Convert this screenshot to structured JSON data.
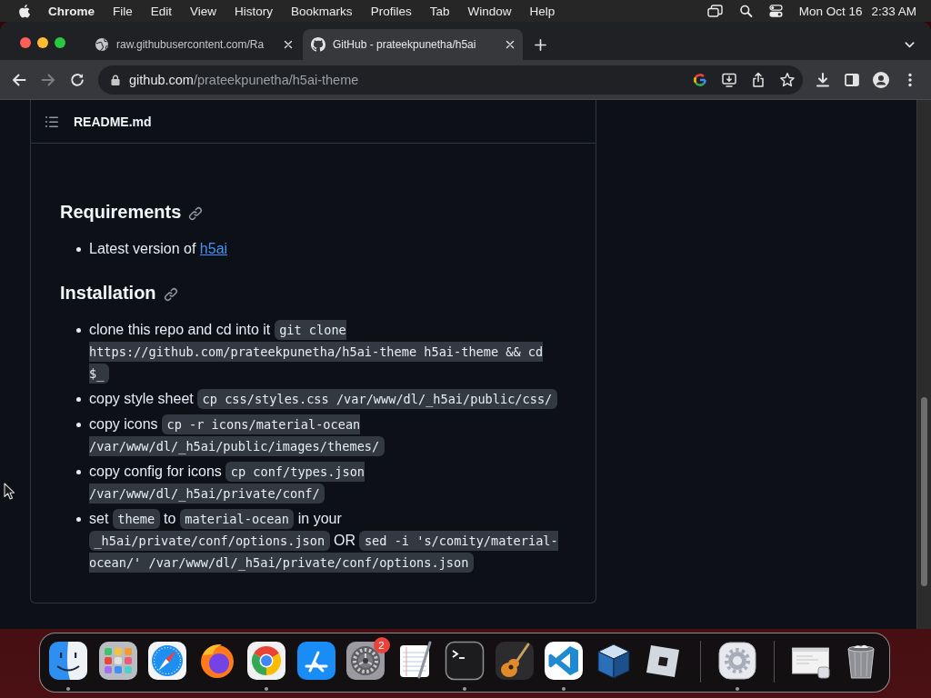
{
  "menu_bar": {
    "app_name": "Chrome",
    "items": [
      "File",
      "Edit",
      "View",
      "History",
      "Bookmarks",
      "Profiles",
      "Tab",
      "Window",
      "Help"
    ],
    "date": "Mon Oct 16",
    "time": "2:33 AM"
  },
  "browser": {
    "tabs": [
      {
        "title": "raw.githubusercontent.com/Ra",
        "selected": false
      },
      {
        "title": "GitHub - prateekpunetha/h5ai",
        "selected": true
      }
    ],
    "toolbar": {
      "back": {
        "disabled": false
      },
      "forward": {
        "disabled": true
      }
    },
    "address": {
      "host": "github.com",
      "path": "/prateekpunetha/h5ai-theme"
    }
  },
  "readme": {
    "file_name": "README.md",
    "sections": [
      {
        "heading": "Requirements",
        "items": [
          {
            "parts": [
              {
                "kind": "text",
                "text": "Latest version of "
              },
              {
                "kind": "link",
                "text": "h5ai"
              }
            ]
          }
        ]
      },
      {
        "heading": "Installation",
        "items": [
          {
            "parts": [
              {
                "kind": "text",
                "text": "clone this repo and cd into it "
              },
              {
                "kind": "code",
                "text": "git clone https://github.com/prateekpunetha/h5ai-theme h5ai-theme && cd $_"
              }
            ]
          },
          {
            "parts": [
              {
                "kind": "text",
                "text": "copy style sheet "
              },
              {
                "kind": "code",
                "text": "cp css/styles.css /var/www/dl/_h5ai/public/css/"
              }
            ]
          },
          {
            "parts": [
              {
                "kind": "text",
                "text": "copy icons "
              },
              {
                "kind": "code",
                "text": "cp -r icons/material-ocean /var/www/dl/_h5ai/public/images/themes/"
              }
            ]
          },
          {
            "parts": [
              {
                "kind": "text",
                "text": "copy config for icons "
              },
              {
                "kind": "code",
                "text": "cp conf/types.json /var/www/dl/_h5ai/private/conf/"
              }
            ]
          },
          {
            "parts": [
              {
                "kind": "text",
                "text": "set "
              },
              {
                "kind": "code",
                "text": "theme"
              },
              {
                "kind": "text",
                "text": " to "
              },
              {
                "kind": "code",
                "text": "material-ocean"
              },
              {
                "kind": "text",
                "text": " in your "
              },
              {
                "kind": "code",
                "text": "_h5ai/private/conf/options.json"
              },
              {
                "kind": "text",
                "text": " OR "
              },
              {
                "kind": "code",
                "text": "sed -i 's/comity/material-ocean/' /var/www/dl/_h5ai/private/conf/options.json"
              }
            ]
          }
        ]
      }
    ]
  },
  "dock": {
    "sections": [
      [
        {
          "running": true
        },
        {
          "running": false
        },
        {
          "running": false
        },
        {
          "running": false
        },
        {
          "running": true
        },
        {
          "running": false
        },
        {
          "running": false,
          "badge": "2"
        },
        {
          "running": false
        },
        {
          "running": true
        },
        {
          "running": false
        },
        {
          "running": true
        },
        {
          "running": false
        },
        {
          "running": false
        }
      ],
      [
        {
          "running": true
        }
      ],
      [
        {
          "running": false
        },
        {
          "running": false
        }
      ]
    ]
  }
}
